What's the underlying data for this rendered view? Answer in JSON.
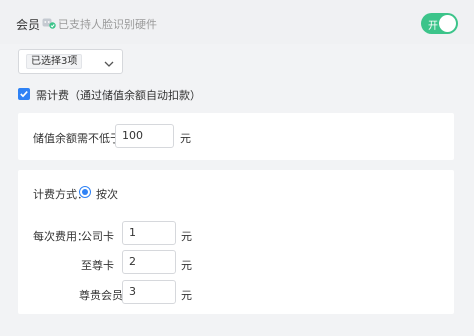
{
  "header": {
    "title": "会员",
    "face_text": "已支持人脸识别硬件",
    "face_icon": "face-recognition-icon",
    "toggle_label": "开",
    "toggle_on": true,
    "accent": "#3cc48a"
  },
  "member_select": {
    "value": "已选择3项",
    "arrow_icon": "chevron-down-icon"
  },
  "billing": {
    "checked": true,
    "label": "需计费（通过储值余额自动扣款）",
    "checkbox_color": "#2f82f5"
  },
  "balance": {
    "label": "储值余额需不低于：",
    "value": "100",
    "unit": "元"
  },
  "charging": {
    "mode_label": "计费方式：",
    "mode_option": "按次",
    "mode_selected": true,
    "fee_label": "每次费用：",
    "rows": [
      {
        "name": "公司卡",
        "value": "1",
        "unit": "元"
      },
      {
        "name": "至尊卡",
        "value": "2",
        "unit": "元"
      },
      {
        "name": "尊贵会员",
        "value": "3",
        "unit": "元"
      }
    ]
  }
}
